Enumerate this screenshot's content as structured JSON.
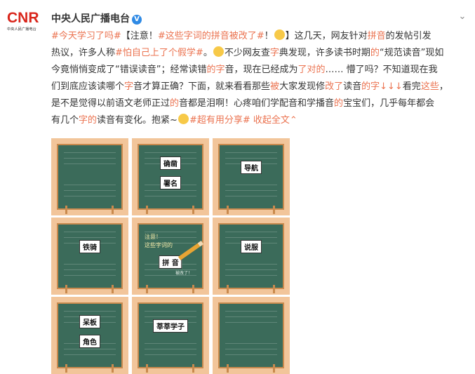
{
  "header": {
    "logo_text": "CNR",
    "logo_subtitle": "中央人民广播电台",
    "author": "中央人民广播电台",
    "verified_mark": "V"
  },
  "post": {
    "line1": [
      {
        "text": "#今天学习了吗#",
        "style": "tag"
      },
      {
        "text": "【注意！",
        "style": "plain"
      },
      {
        "text": "#这些字词的拼音被改了#",
        "style": "tag"
      },
      {
        "text": "！",
        "style": "plain"
      },
      {
        "text": "",
        "style": "emoji"
      },
      {
        "text": "】这几天，网友针对",
        "style": "plain"
      },
      {
        "text": "拼音",
        "style": "hl"
      },
      {
        "text": "的发帖引发",
        "style": "plain"
      }
    ],
    "line2": [
      {
        "text": "热议，许多人称",
        "style": "plain"
      },
      {
        "text": "#怕自己上了个假学#",
        "style": "tag"
      },
      {
        "text": "。",
        "style": "plain"
      },
      {
        "text": "",
        "style": "emoji"
      },
      {
        "text": "不少网友查",
        "style": "plain"
      },
      {
        "text": "字",
        "style": "hl"
      },
      {
        "text": "典发现，许多读书时期",
        "style": "plain"
      },
      {
        "text": "的",
        "style": "hl"
      },
      {
        "text": "“规范读音”现如",
        "style": "plain"
      }
    ],
    "line3": [
      {
        "text": "今竟悄悄变成了“错误读音”；经常读错",
        "style": "plain"
      },
      {
        "text": "的字",
        "style": "hl"
      },
      {
        "text": "音，现在已经成为",
        "style": "plain"
      },
      {
        "text": "了对的",
        "style": "hl"
      },
      {
        "text": "…… 懵了吗？不知道现在我",
        "style": "plain"
      }
    ],
    "line4": [
      {
        "text": "们到底应该读哪个",
        "style": "plain"
      },
      {
        "text": "字",
        "style": "hl"
      },
      {
        "text": "音才算正确？下面，就来看看那些",
        "style": "plain"
      },
      {
        "text": "被",
        "style": "hl"
      },
      {
        "text": "大家发现修",
        "style": "plain"
      },
      {
        "text": "改了",
        "style": "hl"
      },
      {
        "text": "读音",
        "style": "plain"
      },
      {
        "text": "的字↓↓↓",
        "style": "hl"
      },
      {
        "text": "看完",
        "style": "plain"
      },
      {
        "text": "这些",
        "style": "hl"
      },
      {
        "text": "，",
        "style": "plain"
      }
    ],
    "line5": [
      {
        "text": "是不是觉得以前语文老师正过",
        "style": "plain"
      },
      {
        "text": "的",
        "style": "hl"
      },
      {
        "text": "音都是泪啊！心疼咱们学配音和学播音",
        "style": "plain"
      },
      {
        "text": "的",
        "style": "hl"
      },
      {
        "text": "宝宝们，几乎每年都会",
        "style": "plain"
      }
    ],
    "line6": [
      {
        "text": "有几个",
        "style": "plain"
      },
      {
        "text": "字的",
        "style": "hl"
      },
      {
        "text": "读音有变化。抱紧~",
        "style": "plain"
      },
      {
        "text": "",
        "style": "emoji"
      },
      {
        "text": "#超有用分享#",
        "style": "tag"
      },
      {
        "text": " 收起全文",
        "style": "expand"
      },
      {
        "text": "⌃",
        "style": "expand"
      }
    ]
  },
  "images": [
    {
      "card": ""
    },
    {
      "card": "确凿",
      "card2": "署名"
    },
    {
      "card": "导航"
    },
    {
      "card": "铁骑"
    },
    {
      "title1": "注意！",
      "title2": "这些字词的",
      "card": "拼 音",
      "sub": "被改了！"
    },
    {
      "card": "说服"
    },
    {
      "card": "呆板",
      "card2": "角色"
    },
    {
      "card": "莘莘学子"
    },
    {
      "card": ""
    }
  ],
  "colors": {
    "accent": "#eb7350",
    "board": "#3b6b5a",
    "frame": "#f2c59a",
    "verified": "#2f8ae5"
  }
}
